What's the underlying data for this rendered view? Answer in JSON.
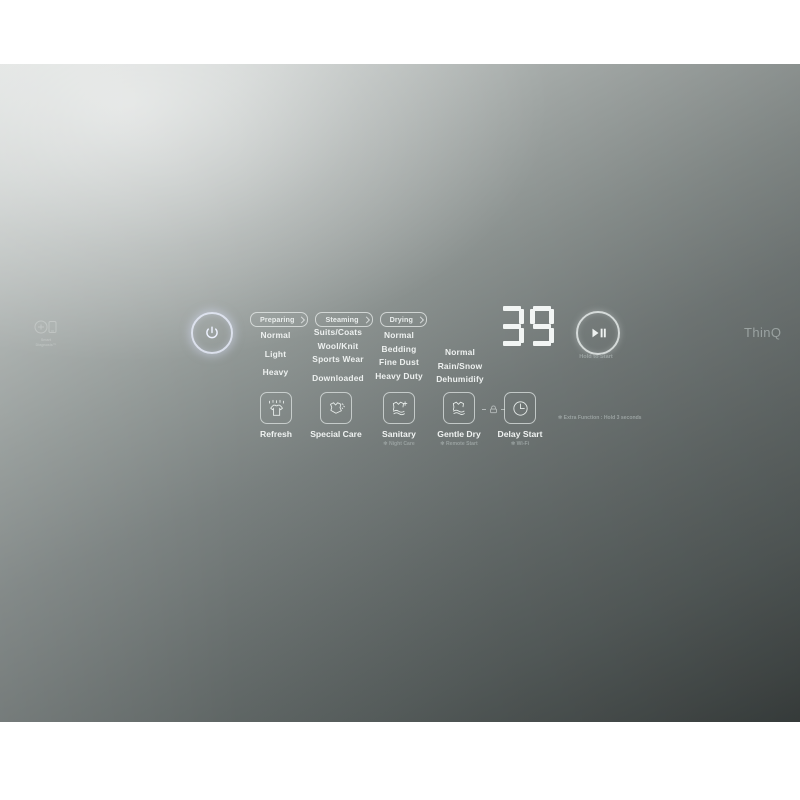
{
  "brand": {
    "logo_text": "ThinQ"
  },
  "smart_diagnosis": {
    "line1": "Smart",
    "line2": "Diagnosis™",
    "icon": "smart-diagnosis-icon"
  },
  "power": {
    "icon": "power-icon",
    "label": ""
  },
  "stage_tabs": [
    {
      "label": "Preparing",
      "icon": "chevron-right-icon"
    },
    {
      "label": "Steaming",
      "icon": "chevron-right-icon"
    },
    {
      "label": "Drying",
      "icon": "chevron-right-icon"
    }
  ],
  "cycle_columns": [
    {
      "name": "column-1",
      "items": [
        "Normal",
        "",
        "Light",
        "",
        "Heavy"
      ]
    },
    {
      "name": "column-2",
      "items": [
        "Suits/Coats",
        "Wool/Knit",
        "Sports Wear",
        "",
        "Downloaded"
      ]
    },
    {
      "name": "column-3",
      "items": [
        "Normal",
        "Bedding",
        "Fine Dust",
        "Heavy Duty"
      ]
    },
    {
      "name": "column-4",
      "items": [
        "Normal",
        "Rain/Snow",
        "Dehumidify"
      ]
    }
  ],
  "display": {
    "value": "39",
    "digits": [
      "3",
      "9"
    ]
  },
  "start_button": {
    "icon": "play-pause-icon",
    "label": "Hold to Start"
  },
  "options": [
    {
      "name": "refresh",
      "icon": "shirt-steam-icon",
      "label": "Refresh",
      "sub": ""
    },
    {
      "name": "special-care",
      "icon": "delicate-garment-icon",
      "label": "Special Care",
      "sub": ""
    },
    {
      "name": "sanitary",
      "icon": "sanitary-plus-icon",
      "label": "Sanitary",
      "sub": "✻ Night Care"
    },
    {
      "name": "gentle-dry",
      "icon": "gentle-dry-icon",
      "label": "Gentle Dry",
      "sub": "✻ Remote Start"
    },
    {
      "name": "delay-start",
      "icon": "clock-icon",
      "label": "Delay Start",
      "sub": "✻ Wi-Fi"
    }
  ],
  "child_lock": {
    "icon": "child-lock-icon"
  },
  "notes": {
    "extra_function": "✻ Extra Function : Hold 3 seconds"
  },
  "colors": {
    "panel_light": "#d4d8d6",
    "panel_dark": "#3b4140",
    "label_text": "#eef1f0",
    "sub_text": "#99a1a0",
    "display_text": "#f2f5f4",
    "power_glow": "#d7deF5"
  }
}
